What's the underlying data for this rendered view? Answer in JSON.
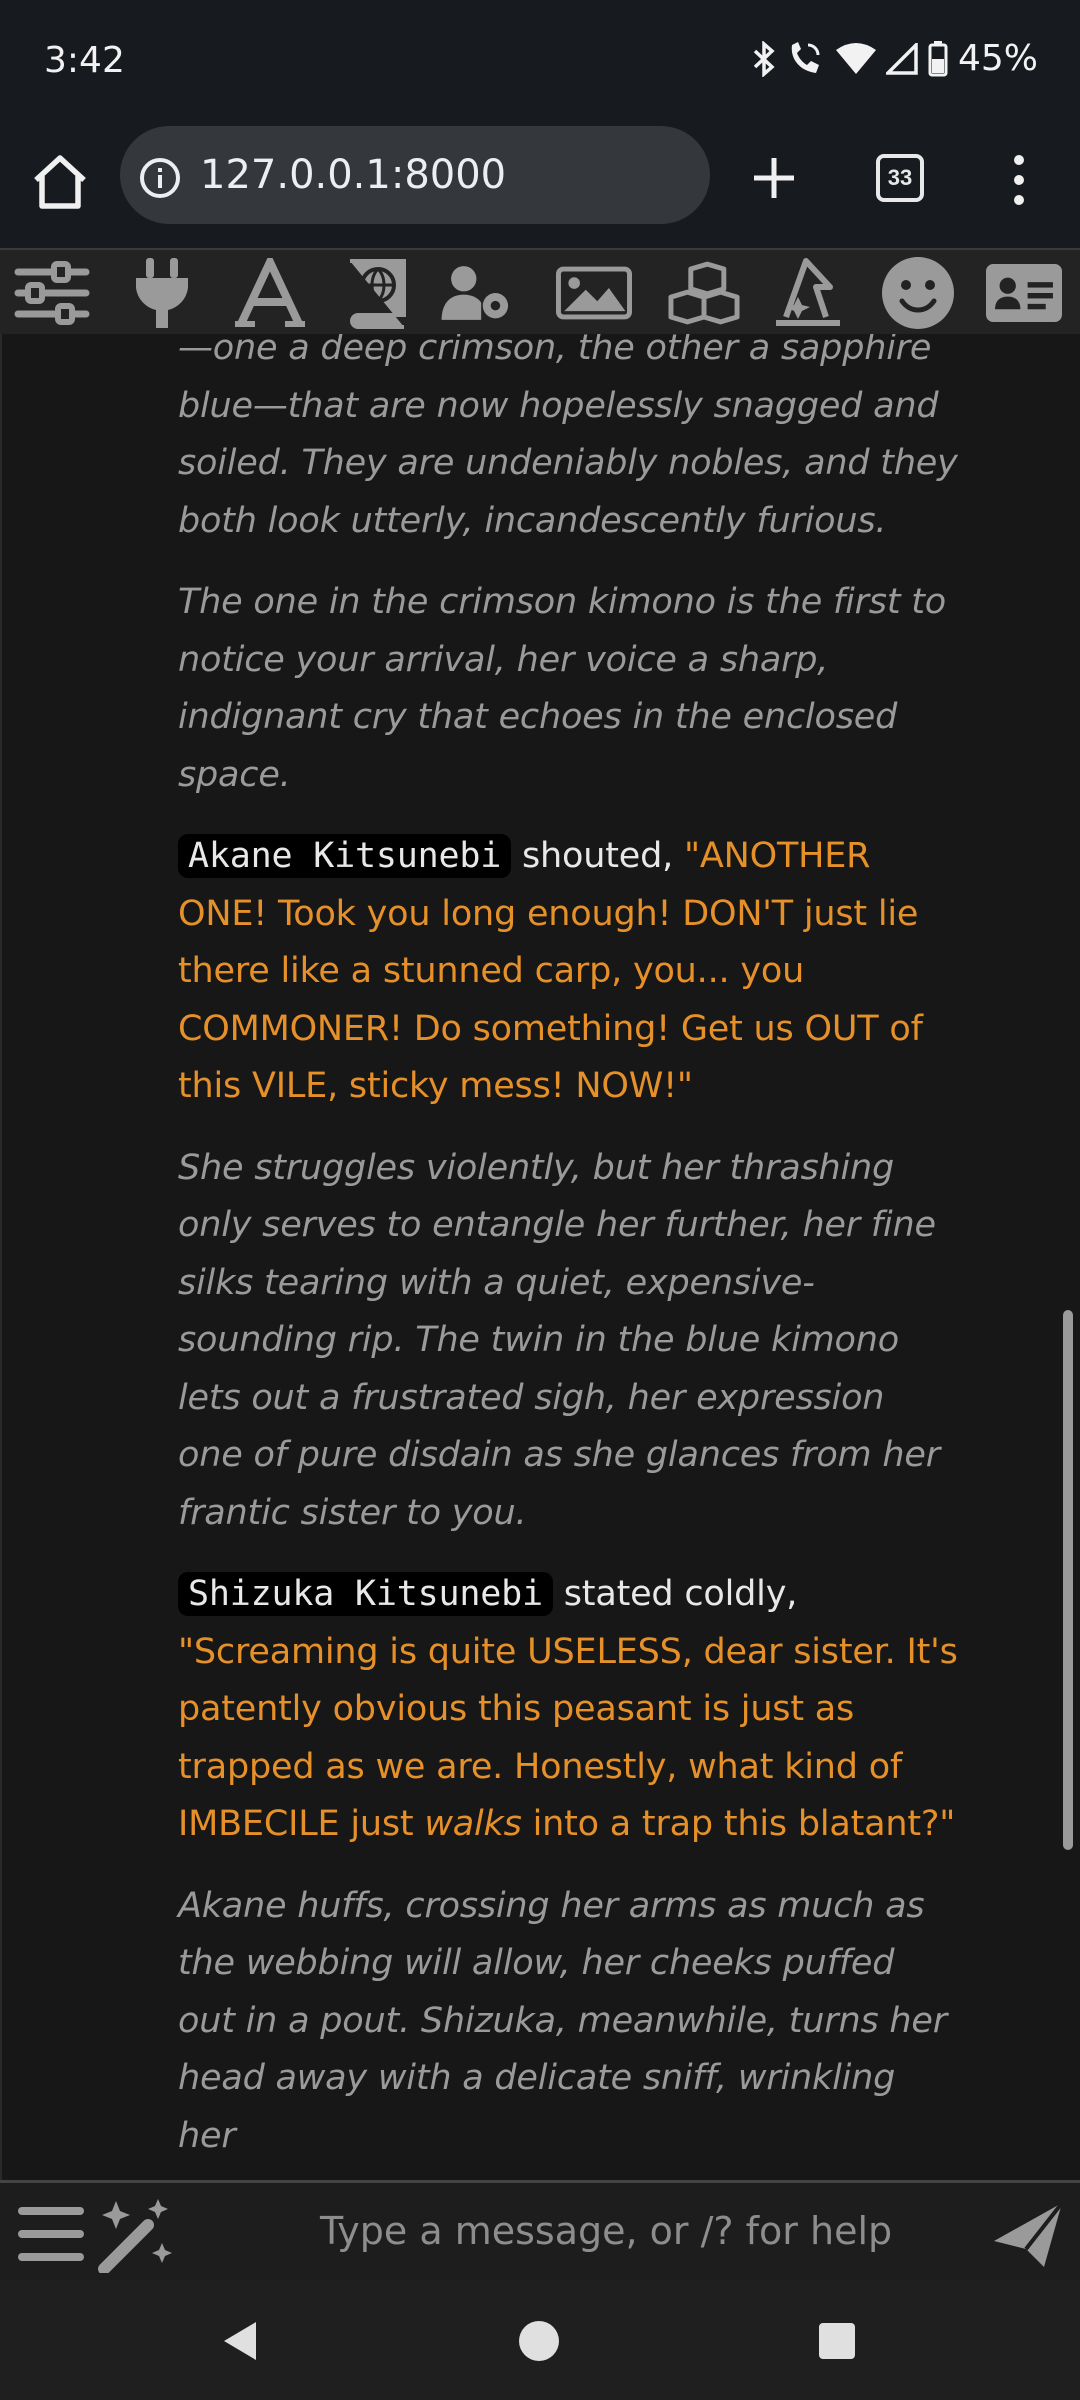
{
  "status_bar": {
    "time": "3:42",
    "battery": "45%"
  },
  "browser": {
    "url": "127.0.0.1:8000",
    "tab_count": "33"
  },
  "toolbar": {
    "icons": [
      "sliders-icon",
      "plug-icon",
      "font-icon",
      "book-globe-icon",
      "user-gear-icon",
      "image-icon",
      "cubes-icon",
      "wizard-hat-icon",
      "smile-icon",
      "id-card-icon"
    ]
  },
  "chat": {
    "p1": "—one a deep crimson, the other a sapphire blue—that are now hopelessly snagged and soiled. They are undeniably nobles, and they both look utterly, incandescently furious.",
    "p2": "The one in the crimson kimono is the first to notice your arrival, her voice a sharp, indignant cry that echoes in the enclosed space.",
    "m1": {
      "speaker": "Akane Kitsunebi",
      "verb": "shouted,",
      "quote": "\"ANOTHER ONE! Took you long enough! DON'T just lie there like a stunned carp, you... you COMMONER! Do something! Get us OUT of this VILE, sticky mess! NOW!\""
    },
    "p3": "She struggles violently, but her thrashing only serves to entangle her further, her fine silks tearing with a quiet, expensive-sounding rip. The twin in the blue kimono lets out a frustrated sigh, her expression one of pure disdain as she glances from her frantic sister to you.",
    "m2": {
      "speaker": "Shizuka Kitsunebi",
      "verb": "stated coldly,",
      "quote_a": "\"Screaming is quite USELESS, dear sister. It's patently obvious this peasant is just as trapped as we are. Honestly, what kind of IMBECILE just ",
      "quote_em": "walks",
      "quote_b": " into a trap this blatant?\""
    },
    "p4": "Akane huffs, crossing her arms as much as the webbing will allow, her cheeks puffed out in a pout. Shizuka, meanwhile, turns her head away with a delicate sniff, wrinkling her"
  },
  "input": {
    "placeholder": "Type a message, or /? for help"
  }
}
